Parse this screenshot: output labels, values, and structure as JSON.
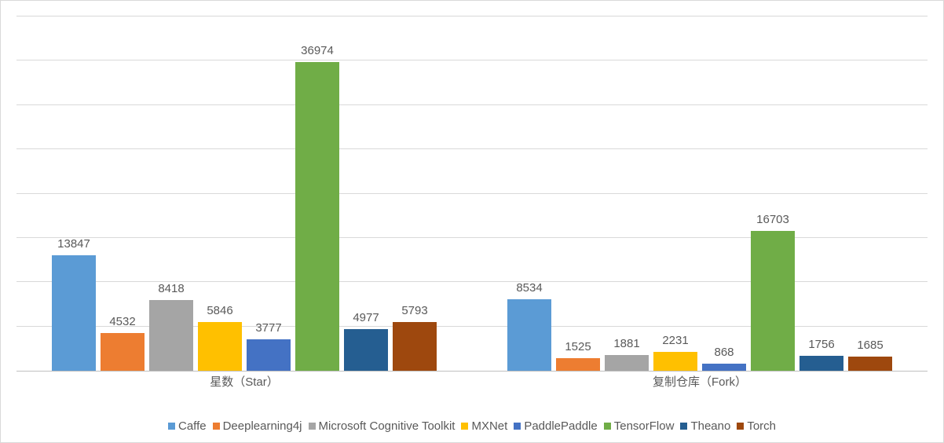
{
  "chart_data": {
    "type": "bar",
    "categories": [
      "星数（Star）",
      "复制仓库（Fork）"
    ],
    "series": [
      {
        "name": "Caffe",
        "values": [
          13847,
          8534
        ],
        "color": "#5b9bd5"
      },
      {
        "name": "Deeplearning4j",
        "values": [
          4532,
          1525
        ],
        "color": "#ed7d31"
      },
      {
        "name": "Microsoft Cognitive Toolkit",
        "values": [
          8418,
          1881
        ],
        "color": "#a5a5a5"
      },
      {
        "name": "MXNet",
        "values": [
          5846,
          2231
        ],
        "color": "#ffc000"
      },
      {
        "name": "PaddlePaddle",
        "values": [
          3777,
          868
        ],
        "color": "#4472c4"
      },
      {
        "name": "TensorFlow",
        "values": [
          36974,
          16703
        ],
        "color": "#70ad47"
      },
      {
        "name": "Theano",
        "values": [
          4977,
          1756
        ],
        "color": "#255e91"
      },
      {
        "name": "Torch",
        "values": [
          5793,
          1685
        ],
        "color": "#9e480e"
      }
    ],
    "ylim": [
      0,
      40000
    ],
    "xlabel": "",
    "ylabel": "",
    "title": "",
    "legend_position": "bottom",
    "grid": true
  }
}
